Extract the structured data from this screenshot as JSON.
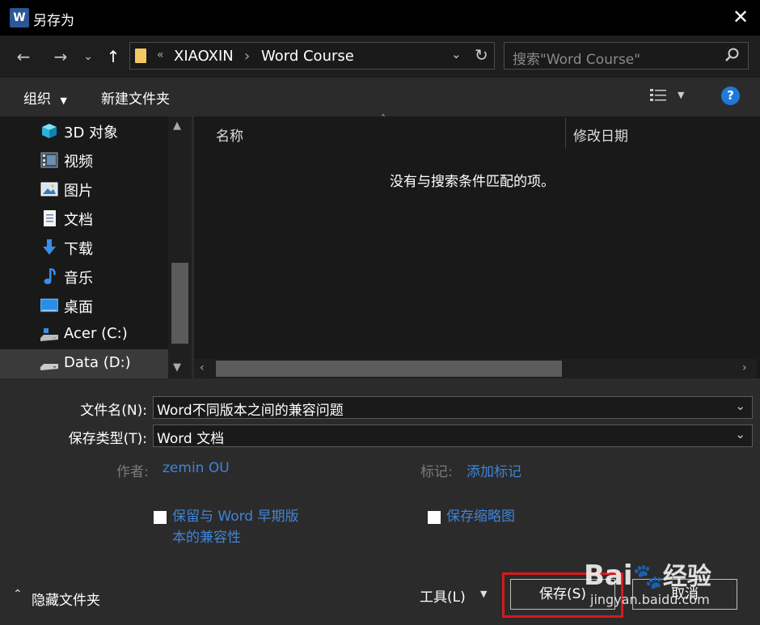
{
  "window": {
    "title": "另存为",
    "app_icon_letter": "W",
    "close_glyph": "✕"
  },
  "address": {
    "overflow": "«",
    "crumbs": [
      "XIAOXIN",
      "Word Course"
    ],
    "separator": "›"
  },
  "search": {
    "placeholder": "搜索\"Word Course\""
  },
  "toolbar": {
    "organize": "组织",
    "new_folder": "新建文件夹",
    "help": "?"
  },
  "nav": {
    "items": [
      {
        "label": "3D 对象",
        "icon": "cube-icon"
      },
      {
        "label": "视频",
        "icon": "film-icon"
      },
      {
        "label": "图片",
        "icon": "picture-icon"
      },
      {
        "label": "文档",
        "icon": "document-icon"
      },
      {
        "label": "下载",
        "icon": "download-icon"
      },
      {
        "label": "音乐",
        "icon": "music-icon"
      },
      {
        "label": "桌面",
        "icon": "desktop-icon"
      },
      {
        "label": "Acer (C:)",
        "icon": "drive-icon"
      },
      {
        "label": "Data (D:)",
        "icon": "drive-icon"
      }
    ]
  },
  "files": {
    "columns": [
      "名称",
      "修改日期"
    ],
    "empty_message": "没有与搜索条件匹配的项。"
  },
  "form": {
    "filename_label": "文件名(N):",
    "filename_value": "Word不同版本之间的兼容问题",
    "type_label": "保存类型(T):",
    "type_value": "Word 文档",
    "author_label": "作者:",
    "author_value": "zemin OU",
    "tags_label": "标记:",
    "tags_value": "添加标记",
    "compat_label_1": "保留与 Word 早期版",
    "compat_label_2": "本的兼容性",
    "thumbnail_label": "保存缩略图"
  },
  "footer": {
    "hide_folders": "隐藏文件夹",
    "tools": "工具(L)",
    "save": "保存(S)",
    "cancel": "取消"
  },
  "watermark": {
    "brand": "Bai",
    "brand2": "经验",
    "url": "jingyan.baidu.com"
  },
  "colors": {
    "accent": "#1d7ad8",
    "link": "#3f84d6",
    "highlight_frame": "#d7191e"
  }
}
